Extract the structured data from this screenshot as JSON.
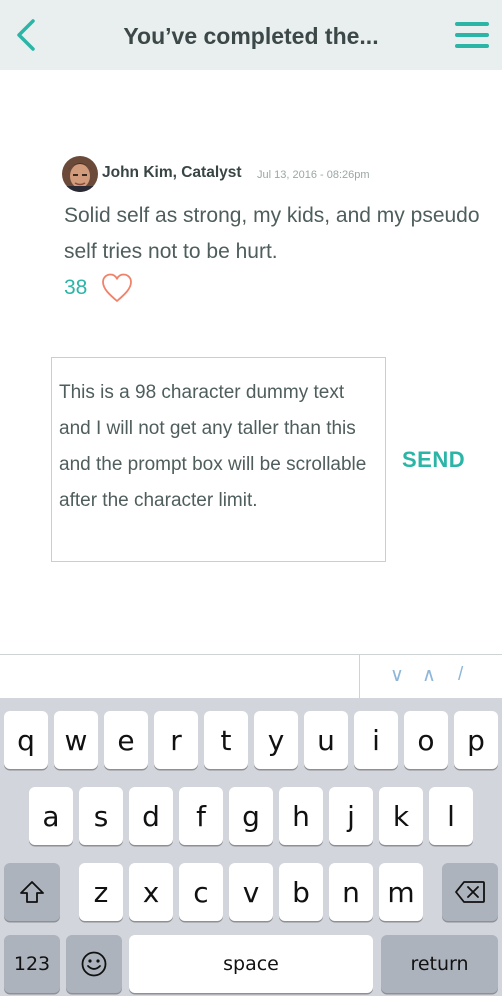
{
  "header": {
    "title": "You’ve completed the...",
    "back_icon": "chevron-left-icon",
    "menu_icon": "hamburger-menu-icon",
    "accent_color": "#2bb5a6",
    "background_color": "#e9eeee"
  },
  "comment": {
    "author": "John Kim, Catalyst",
    "timestamp": "Jul 13, 2016 - 08:26pm",
    "body": "Solid self as strong, my kids, and my pseudo self tries not to be hurt.",
    "likes": "38",
    "like_icon": "heart-outline-icon",
    "heart_color": "#f0826a"
  },
  "prompt": {
    "text": "This is a 98 character dummy text and I will not get any taller than this and the prompt box will be scrollable after the character limit.",
    "send_label": "SEND"
  },
  "accessory": {
    "down_label": "∨",
    "up_label": "∧",
    "done_label": "/"
  },
  "keyboard": {
    "row1": [
      "q",
      "w",
      "e",
      "r",
      "t",
      "y",
      "u",
      "i",
      "o",
      "p"
    ],
    "row2": [
      "a",
      "s",
      "d",
      "f",
      "g",
      "h",
      "j",
      "k",
      "l"
    ],
    "row3": [
      "z",
      "x",
      "c",
      "v",
      "b",
      "n",
      "m"
    ],
    "shift_icon": "shift-icon",
    "delete_icon": "backspace-icon",
    "numbers_label": "123",
    "emoji_icon": "emoji-icon",
    "space_label": "space",
    "return_label": "return"
  }
}
